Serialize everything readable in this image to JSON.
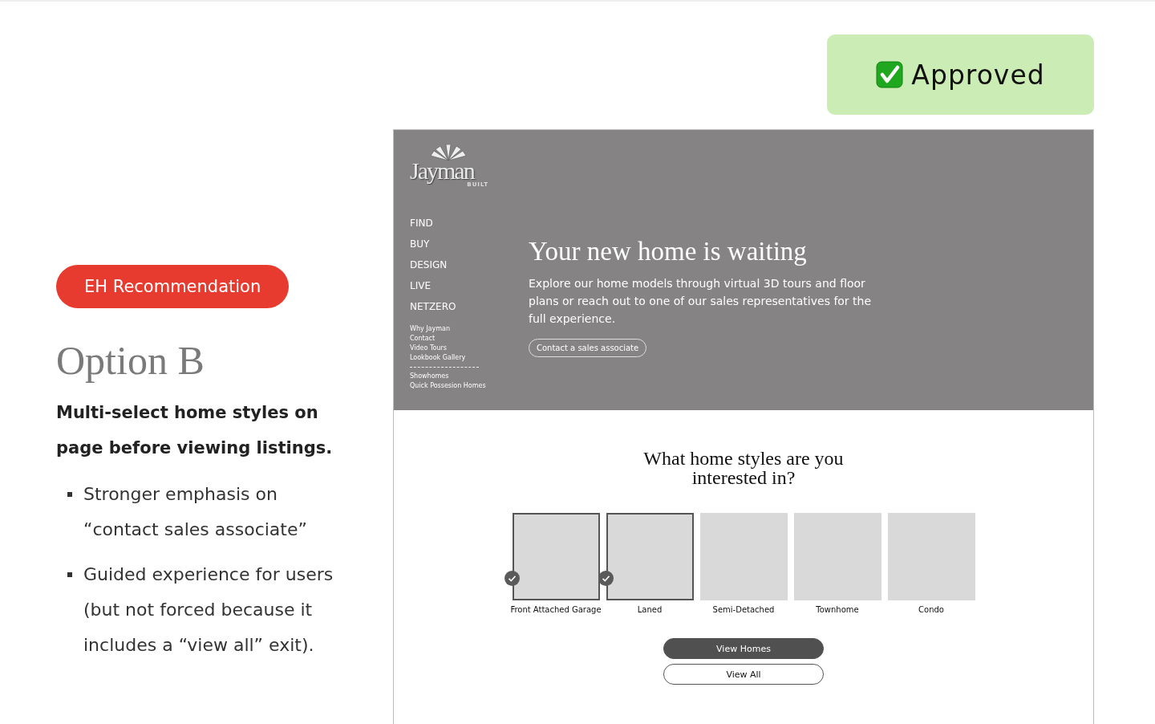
{
  "status_badge": {
    "label": "Approved"
  },
  "recommendation_tag": "EH Recommendation",
  "option": {
    "title": "Option B",
    "summary": "Multi-select home styles on page before viewing listings.",
    "points": [
      "Stronger emphasis on “contact sales associate”",
      "Guided experience for users (but not forced because it includes a “view all” exit)."
    ]
  },
  "mockup": {
    "logo": {
      "name": "Jayman",
      "sub": "BUILT"
    },
    "nav": {
      "primary": [
        "FIND",
        "BUY",
        "DESIGN",
        "LIVE",
        "NETZERO"
      ],
      "secondary": [
        "Why Jayman",
        "Contact",
        "Video Tours",
        "Lookbook Gallery"
      ],
      "tertiary": [
        "Showhomes",
        "Quick Possesion Homes"
      ]
    },
    "hero": {
      "title": "Your new home is waiting",
      "body": "Explore our home models through virtual 3D tours and floor plans or reach out to one of our sales representatives for the full experience.",
      "button": "Contact a sales associate"
    },
    "selector": {
      "question": "What home styles are you interested in?",
      "styles": [
        {
          "label": "Front Attached Garage",
          "selected": true
        },
        {
          "label": "Laned",
          "selected": true
        },
        {
          "label": "Semi-Detached",
          "selected": false
        },
        {
          "label": "Townhome",
          "selected": false
        },
        {
          "label": "Condo",
          "selected": false
        }
      ],
      "buttons": [
        {
          "label": "View Homes",
          "kind": "primary"
        },
        {
          "label": "View All",
          "kind": "secondary"
        }
      ]
    }
  }
}
